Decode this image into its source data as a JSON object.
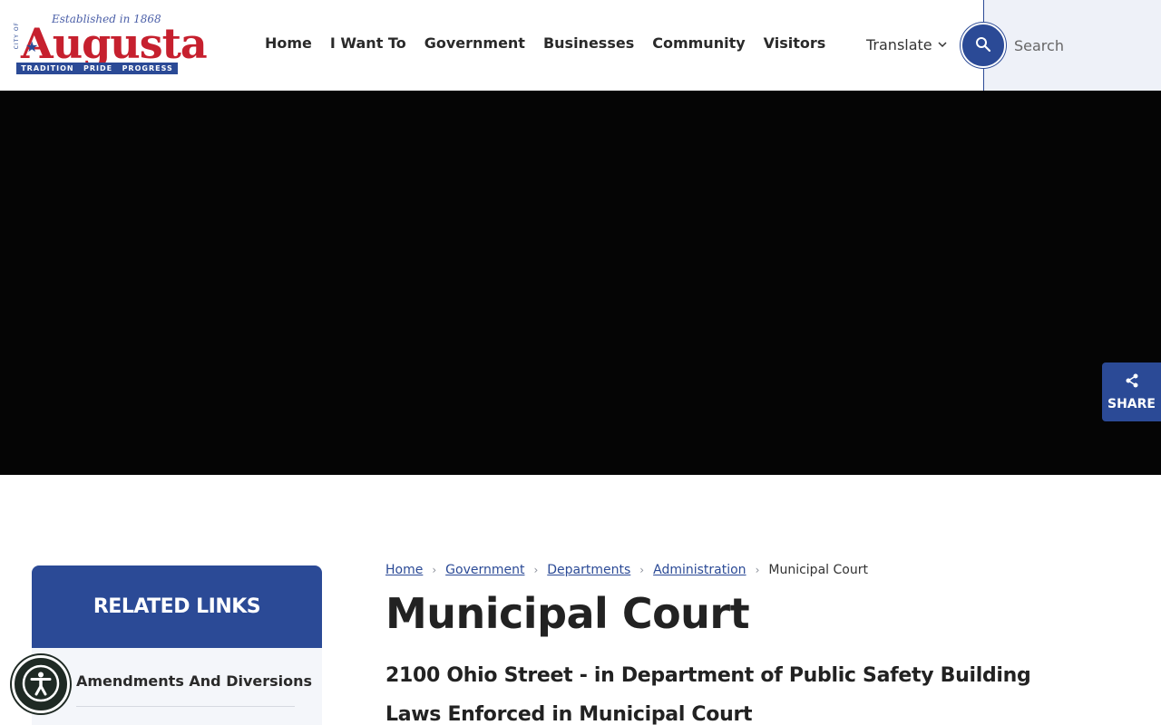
{
  "logo": {
    "established": "Established in 1868",
    "city_of": "CITY OF",
    "wordmark": "Augusta",
    "tagline": [
      "TRADITION",
      "PRIDE",
      "PROGRESS"
    ]
  },
  "nav": {
    "items": [
      {
        "label": "Home"
      },
      {
        "label": "I Want To"
      },
      {
        "label": "Government"
      },
      {
        "label": "Businesses"
      },
      {
        "label": "Community"
      },
      {
        "label": "Visitors"
      }
    ]
  },
  "translate": {
    "label": "Translate"
  },
  "search": {
    "placeholder": "Search"
  },
  "share": {
    "label": "SHARE"
  },
  "related": {
    "title": "RELATED LINKS",
    "items": [
      {
        "label": "Amendments And Diversions"
      }
    ]
  },
  "breadcrumb": {
    "links": [
      "Home",
      "Government",
      "Departments",
      "Administration"
    ],
    "current": "Municipal Court"
  },
  "content": {
    "title": "Municipal Court",
    "subheads": [
      "2100 Ohio Street - in Department of Public Safety Building",
      "Laws Enforced in Municipal Court"
    ]
  },
  "colors": {
    "brand_blue": "#2b4a96",
    "brand_red": "#c6202e",
    "hero_bg": "#050505"
  }
}
